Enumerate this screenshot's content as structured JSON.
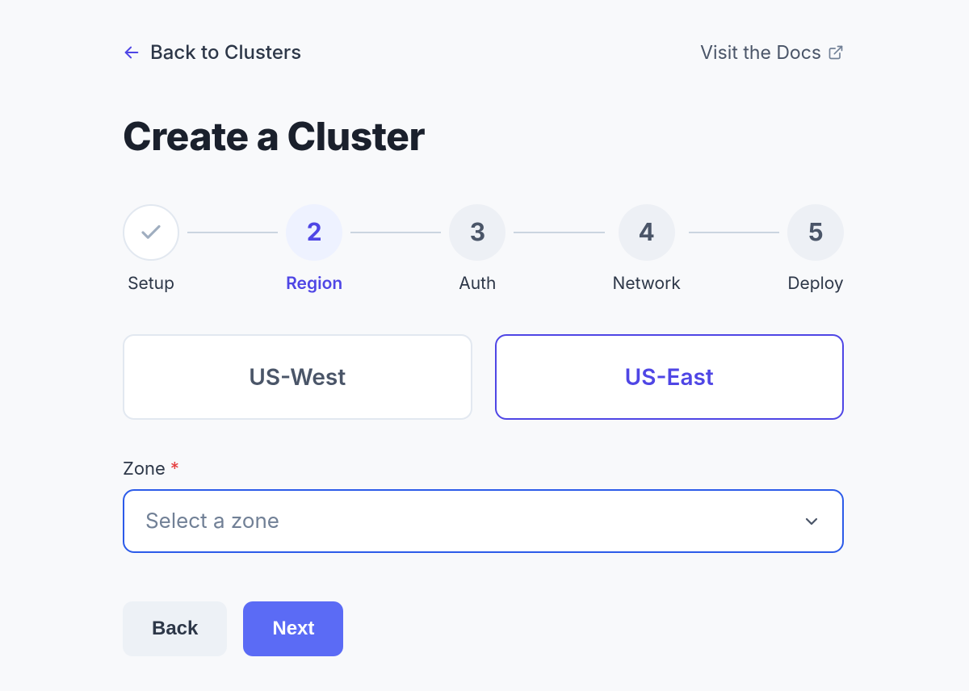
{
  "nav": {
    "back_label": "Back to Clusters",
    "docs_label": "Visit the Docs"
  },
  "page": {
    "title": "Create a Cluster"
  },
  "stepper": {
    "steps": [
      {
        "label": "Setup",
        "state": "completed"
      },
      {
        "label": "Region",
        "state": "current",
        "number": "2"
      },
      {
        "label": "Auth",
        "state": "upcoming",
        "number": "3"
      },
      {
        "label": "Network",
        "state": "upcoming",
        "number": "4"
      },
      {
        "label": "Deploy",
        "state": "upcoming",
        "number": "5"
      }
    ]
  },
  "region": {
    "options": [
      {
        "label": "US-West",
        "selected": false
      },
      {
        "label": "US-East",
        "selected": true
      }
    ]
  },
  "zone": {
    "label": "Zone",
    "required_marker": "*",
    "placeholder": "Select a zone"
  },
  "actions": {
    "back": "Back",
    "next": "Next"
  },
  "colors": {
    "accent": "#4F46E5",
    "primary_button": "#5B6BF5",
    "required": "#E53E3E"
  }
}
